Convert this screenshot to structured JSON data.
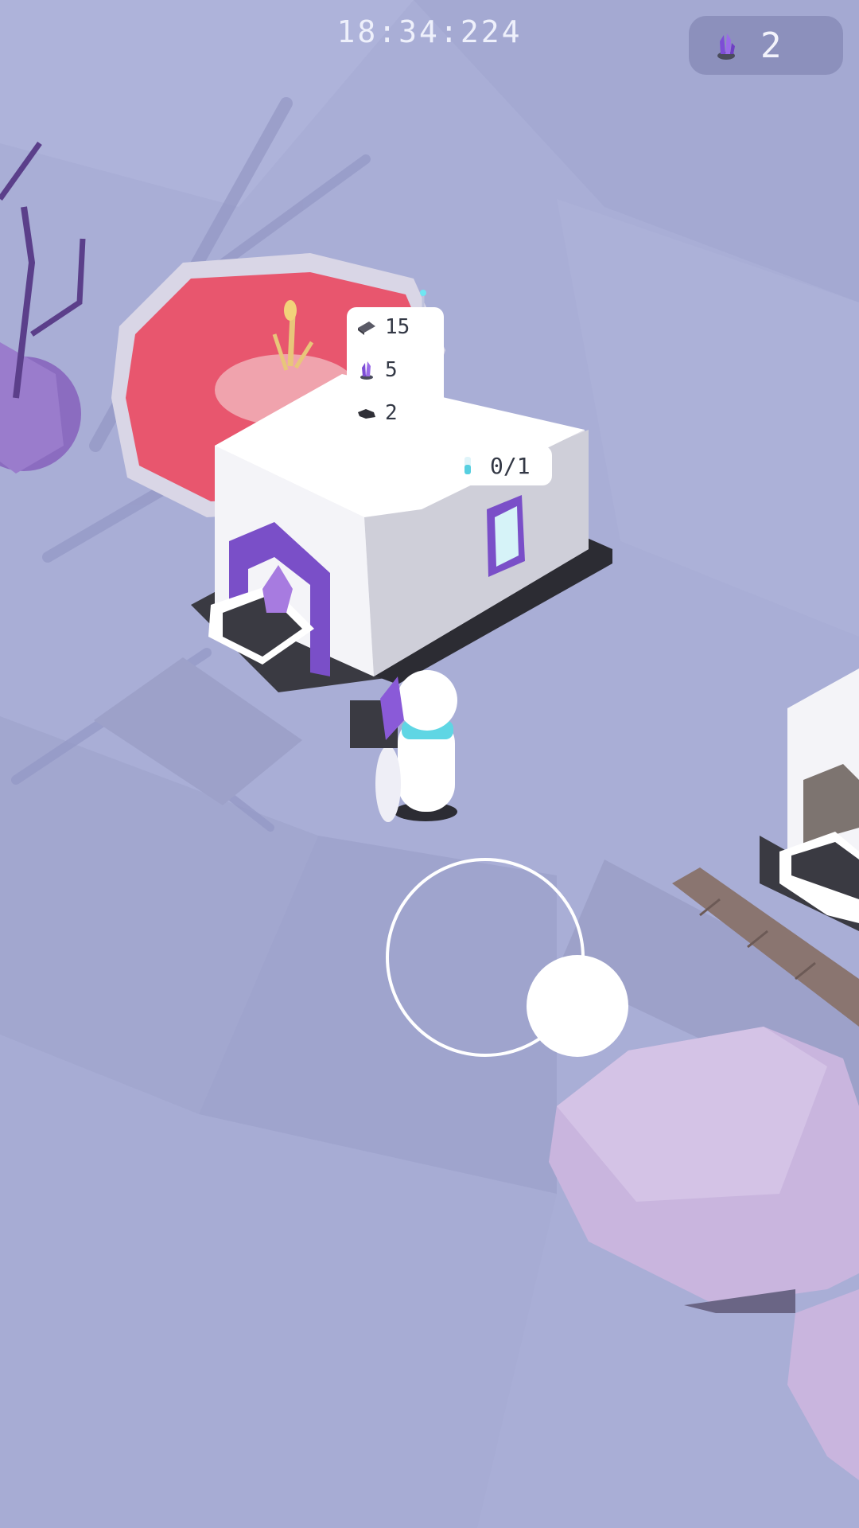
{
  "hud": {
    "timer": "18:34:224",
    "gem_count": "2",
    "gem_icon": "purple-crystal-icon"
  },
  "building": {
    "requirements": [
      {
        "icon": "metal-plate-icon",
        "value": "15"
      },
      {
        "icon": "purple-crystal-icon",
        "value": "5"
      },
      {
        "icon": "dark-stone-icon",
        "value": "2"
      }
    ],
    "capacity": {
      "icon": "blue-vial-icon",
      "value": "0/1"
    }
  },
  "colors": {
    "ground": "#a9aed6",
    "pool_red": "#e85a72",
    "building_white": "#f4f4f8",
    "accent_purple": "#7a4fc8",
    "rock_lavender": "#c8b7dc"
  }
}
